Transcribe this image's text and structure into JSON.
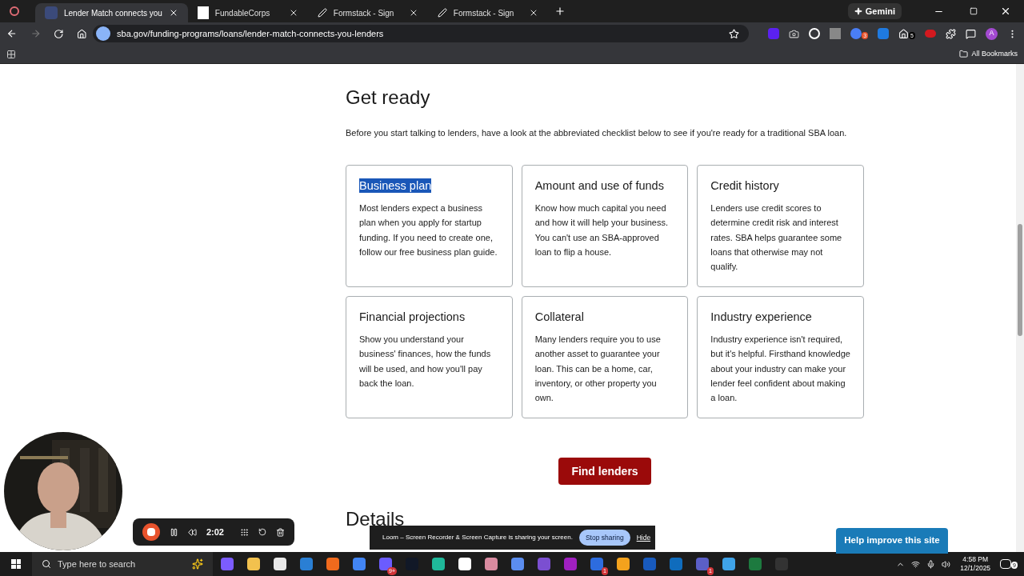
{
  "browser": {
    "tabs": [
      {
        "title": "Lender Match connects you",
        "selected": true,
        "kind": "favicon"
      },
      {
        "title": "FundableCorps",
        "selected": false,
        "kind": "page"
      },
      {
        "title": "Formstack - Sign",
        "selected": false,
        "kind": "pen"
      },
      {
        "title": "Formstack - Sign",
        "selected": false,
        "kind": "pen"
      }
    ],
    "gemini": "Gemini",
    "url": "sba.gov/funding-programs/loans/lender-match-connects-you-lenders",
    "profile": "A",
    "all_bookmarks": "All Bookmarks",
    "extension_badges": [
      "3",
      "5"
    ]
  },
  "page": {
    "heading": "Get ready",
    "intro": "Before you start talking to lenders, have a look at the abbreviated checklist below to see if you're ready for a traditional SBA loan.",
    "cards": [
      {
        "title": "Business plan",
        "highlighted": true,
        "text": "Most lenders expect a business plan when you apply for startup funding. If you need to create one, follow our free business plan guide."
      },
      {
        "title": "Amount and use of funds",
        "highlighted": false,
        "text": "Know how much capital you need and how it will help your business. You can't use an SBA-approved loan to flip a house."
      },
      {
        "title": "Credit history",
        "highlighted": false,
        "text": "Lenders use credit scores to determine credit risk and interest rates. SBA helps guarantee some loans that otherwise may not qualify."
      },
      {
        "title": "Financial projections",
        "highlighted": false,
        "text": "Show you understand your business' finances, how the funds will be used, and how you'll pay back the loan."
      },
      {
        "title": "Collateral",
        "highlighted": false,
        "text": "Many lenders require you to use another asset to guarantee your loan. This can be a home, car, inventory, or other property you own."
      },
      {
        "title": "Industry experience",
        "highlighted": false,
        "text": "Industry experience isn't required, but it's helpful. Firsthand knowledge about your industry can make your lender feel confident about making a loan."
      }
    ],
    "cta": "Find lenders",
    "next_heading": "Details",
    "help_button": "Help improve this site"
  },
  "recorder": {
    "time": "2:02"
  },
  "share_bar": {
    "message": "Loom – Screen Recorder & Screen Capture is sharing your screen.",
    "stop": "Stop sharing",
    "hide": "Hide"
  },
  "taskbar": {
    "search_placeholder": "Type here to search",
    "apps": [
      {
        "color": "#7c5cff"
      },
      {
        "color": "#f2c14e"
      },
      {
        "color": "#e8e8e8"
      },
      {
        "color": "#2a7fd4"
      },
      {
        "color": "#f06a1d"
      },
      {
        "color": "#4285f4"
      },
      {
        "color": "#6b5cff",
        "badge": "9+"
      },
      {
        "color": "#111827"
      },
      {
        "color": "#1fb89a"
      },
      {
        "color": "#ffffff"
      },
      {
        "color": "#d98ba0"
      },
      {
        "color": "#5b8def"
      },
      {
        "color": "#7b4fd1"
      },
      {
        "color": "#a020c0"
      },
      {
        "color": "#2d6cdf",
        "badge": "1"
      },
      {
        "color": "#f4a21d"
      },
      {
        "color": "#185abd"
      },
      {
        "color": "#0f6cbd"
      },
      {
        "color": "#5b5fc7",
        "badge": "1"
      },
      {
        "color": "#3fa3e8"
      },
      {
        "color": "#1d7a3f"
      },
      {
        "color": "#333333"
      }
    ],
    "time": "4:58 PM",
    "date": "12/1/2025",
    "notifications": "9"
  }
}
